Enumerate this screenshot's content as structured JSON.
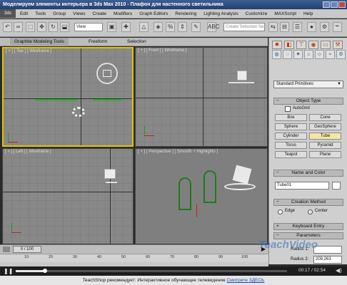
{
  "window": {
    "title": "Моделируем элементы интерьера в 3ds Max 2010 - Плафон для настенного светильника"
  },
  "menu": {
    "logo": "3ds",
    "items": [
      "Edit",
      "Tools",
      "Group",
      "Views",
      "Create",
      "Modifiers",
      "Graph Editors",
      "Rendering",
      "Lighting Analysis",
      "Customize",
      "MAXScript",
      "Help"
    ]
  },
  "toolbar": {
    "view_select": "View",
    "selection_set_placeholder": "Create Selection Se"
  },
  "ribbon": {
    "tabs": [
      "Graphite Modeling Tools",
      "Freeform",
      "Selection"
    ]
  },
  "viewports": {
    "top": "[ + ] [ Top ] [ Wireframe ]",
    "front": "[ + ] [ Front ] [ Wireframe ]",
    "left": "[ + ] [ Left ] [ Wireframe ]",
    "perspective": "[ + ] [ Perspective ] [ Smooth + Highlights ]"
  },
  "command_panel": {
    "category": "Standard Primitives",
    "object_type_title": "Object Type",
    "autogrid": "AutoGrid",
    "buttons": [
      "Box",
      "Cone",
      "Sphere",
      "GeoSphere",
      "Cylinder",
      "Tube",
      "Torus",
      "Pyramid",
      "Teapot",
      "Plane"
    ],
    "active_button": "Tube",
    "name_color_title": "Name and Color",
    "object_name": "Tube01",
    "creation_method_title": "Creation Method",
    "edge_label": "Edge",
    "center_label": "Center",
    "keyboard_entry": "Keyboard Entry",
    "parameters": "Parameters",
    "radius1_label": "Radius 1:",
    "radius2_label": "Radius 2:",
    "radius2_value": "209,263"
  },
  "timeline": {
    "frame": "0 / 100",
    "ticks": [
      "10",
      "20",
      "30",
      "40",
      "50",
      "60",
      "70",
      "80",
      "90",
      "100"
    ]
  },
  "player": {
    "time": "00:17 / 02:54"
  },
  "watermark": "TeachVideo",
  "bottom_bar": {
    "text": "TeachShop рекомендует: Интерактивное обучающее телевидение",
    "link": "Смотрите ЗДЕСЬ"
  }
}
